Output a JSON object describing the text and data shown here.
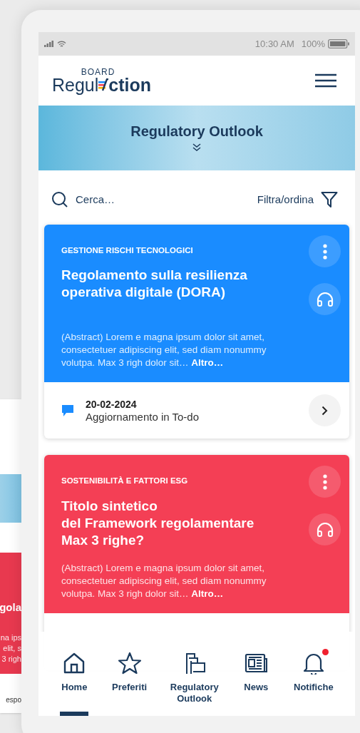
{
  "back_screen": {
    "title_fragment": "gola",
    "abstract_fragments": [
      "na ips",
      "elit, s",
      "3 righ"
    ],
    "footer_fragment": "espo"
  },
  "status_bar": {
    "time": "10:30 AM",
    "battery": "100%"
  },
  "header": {
    "brand_top": "BOARD",
    "brand_left": "Regul",
    "brand_right": "ction"
  },
  "banner": {
    "title": "Regulatory Outlook"
  },
  "search": {
    "placeholder": "Cerca…",
    "filter_label": "Filtra/ordina"
  },
  "cards": [
    {
      "color": "#1a8cff",
      "category": "GESTIONE RISCHI TECNOLOGICI",
      "title": "Regolamento sulla resilienza operativa digitale (DORA)",
      "abstract": "(Abstract) Lorem e magna ipsum dolor sit amet, consectetuer adipiscing elit, sed diam nonummy volutpa. Max 3 righ dolor sit…",
      "more": "Altro…",
      "footer": {
        "date": "20-02-2024",
        "note": "Aggiornamento in To-do"
      }
    },
    {
      "color": "#f43f55",
      "category": "SOSTENIBILITÀ E FATTORI ESG",
      "title": "Titolo sintetico\ndel Framework regolamentare\nMax 3 righe?",
      "abstract": "(Abstract) Lorem e magna ipsum dolor sit amet, consectetuer adipiscing elit, sed diam nonummy volutpa. Max 3 righ dolor sit…",
      "more": "Altro…"
    }
  ],
  "bottom_nav": [
    {
      "label": "Home",
      "selected": true,
      "alert": false
    },
    {
      "label": "Preferiti",
      "selected": false,
      "alert": false
    },
    {
      "label": "Regulatory\nOutlook",
      "selected": false,
      "alert": false
    },
    {
      "label": "News",
      "selected": false,
      "alert": false
    },
    {
      "label": "Notifiche",
      "selected": false,
      "alert": true
    }
  ]
}
